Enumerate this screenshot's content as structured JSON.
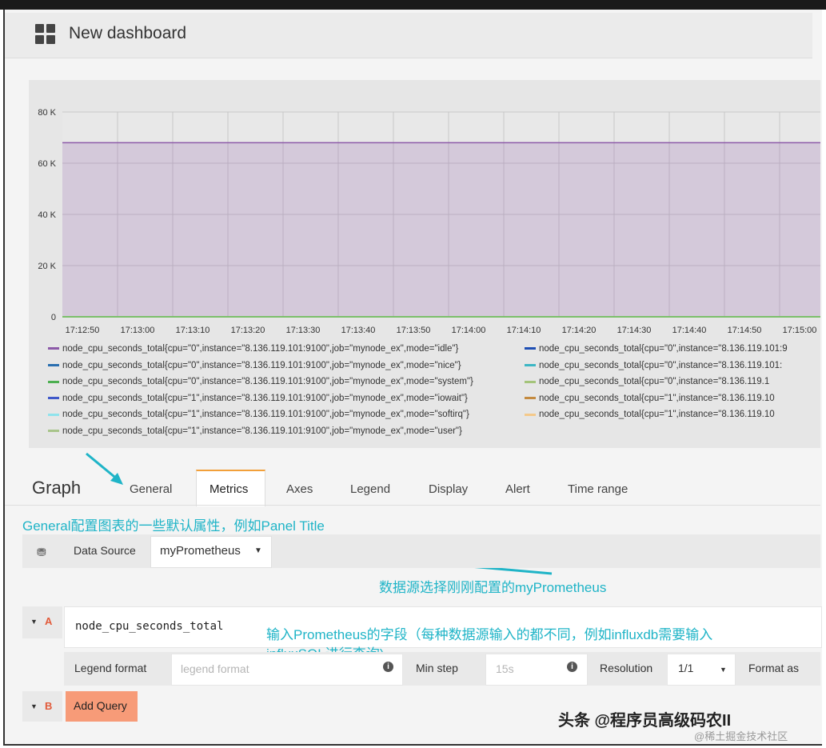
{
  "header": {
    "title": "New dashboard"
  },
  "chart_data": {
    "type": "area",
    "ylim": [
      0,
      80000
    ],
    "yticks": [
      "0",
      "20 K",
      "40 K",
      "60 K",
      "80 K"
    ],
    "x": [
      "17:12:50",
      "17:13:00",
      "17:13:10",
      "17:13:20",
      "17:13:30",
      "17:13:40",
      "17:13:50",
      "17:14:00",
      "17:14:10",
      "17:14:20",
      "17:14:30",
      "17:14:40",
      "17:14:50",
      "17:15:00"
    ],
    "series": [
      {
        "name": "node_cpu_seconds_total{cpu=\"0\",instance=\"8.136.119.101:9100\",job=\"mynode_ex\",mode=\"idle\"}",
        "color": "#8c5aa8",
        "value": 68000
      }
    ],
    "grid": true
  },
  "legend": [
    {
      "text": "node_cpu_seconds_total{cpu=\"0\",instance=\"8.136.119.101:9100\",job=\"mynode_ex\",mode=\"idle\"}",
      "color": "#8c5aa8"
    },
    {
      "text": "node_cpu_seconds_total{cpu=\"0\",instance=\"8.136.119.101:9",
      "color": "#1f4fb4"
    },
    {
      "text": "node_cpu_seconds_total{cpu=\"0\",instance=\"8.136.119.101:9100\",job=\"mynode_ex\",mode=\"nice\"}",
      "color": "#2a6fb0"
    },
    {
      "text": "node_cpu_seconds_total{cpu=\"0\",instance=\"8.136.119.101:",
      "color": "#3cb6c4"
    },
    {
      "text": "node_cpu_seconds_total{cpu=\"0\",instance=\"8.136.119.101:9100\",job=\"mynode_ex\",mode=\"system\"}",
      "color": "#4caf50"
    },
    {
      "text": "node_cpu_seconds_total{cpu=\"0\",instance=\"8.136.119.1",
      "color": "#a4c47a"
    },
    {
      "text": "node_cpu_seconds_total{cpu=\"1\",instance=\"8.136.119.101:9100\",job=\"mynode_ex\",mode=\"iowait\"}",
      "color": "#3f58c9"
    },
    {
      "text": "node_cpu_seconds_total{cpu=\"1\",instance=\"8.136.119.10",
      "color": "#c48a3f"
    },
    {
      "text": "node_cpu_seconds_total{cpu=\"1\",instance=\"8.136.119.101:9100\",job=\"mynode_ex\",mode=\"softirq\"}",
      "color": "#8fe3ec"
    },
    {
      "text": "node_cpu_seconds_total{cpu=\"1\",instance=\"8.136.119.10",
      "color": "#f4c98a"
    },
    {
      "text": "node_cpu_seconds_total{cpu=\"1\",instance=\"8.136.119.101:9100\",job=\"mynode_ex\",mode=\"user\"}",
      "color": "#a8c48a"
    }
  ],
  "editor": {
    "title": "Graph",
    "tabs": [
      "General",
      "Metrics",
      "Axes",
      "Legend",
      "Display",
      "Alert",
      "Time range"
    ],
    "active_tab": "Metrics"
  },
  "notes": {
    "general": "General配置图表的一些默认属性，例如Panel Title",
    "datasource": "数据源选择刚刚配置的myPrometheus",
    "query_line1": "输入Prometheus的字段（每种数据源输入的都不同，例如influxdb需要输入",
    "query_line2": "influxSQL进行查询)"
  },
  "datasource": {
    "label": "Data Source",
    "value": "myPrometheus"
  },
  "query_a": {
    "letter": "A",
    "expr": "node_cpu_seconds_total",
    "legend_label": "Legend format",
    "legend_placeholder": "legend format",
    "min_step_label": "Min step",
    "min_step_placeholder": "15s",
    "resolution_label": "Resolution",
    "resolution_value": "1/1",
    "format_label": "Format as"
  },
  "query_b": {
    "letter": "B",
    "add_label": "Add Query"
  },
  "watermark": {
    "main": "头条 @程序员高级码农II",
    "sub": "@稀土掘金技术社区"
  },
  "colors": {
    "accent": "#f2a03a",
    "annotation": "#1fb4c7",
    "add_query": "#f79b78"
  }
}
